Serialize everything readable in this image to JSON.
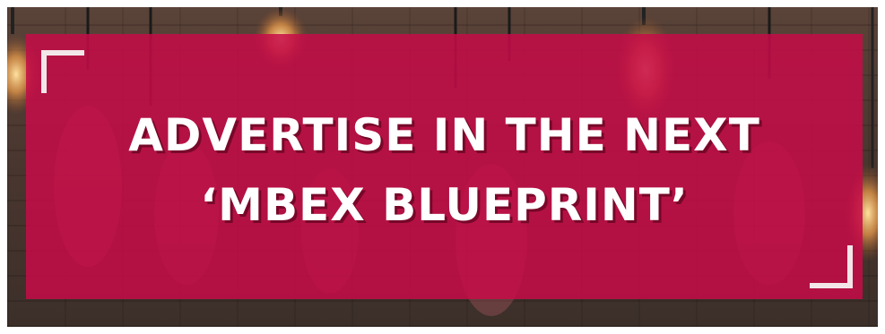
{
  "banner": {
    "line1": "ADVERTISE IN THE NEXT",
    "line2": "‘MBEX BLUEPRINT’"
  },
  "colors": {
    "overlay": "#c60c48",
    "text": "#ffffff",
    "corner": "#f2e6e9",
    "background": "#4a372f"
  },
  "icons": {
    "background_image": "hanging-light-bulbs"
  }
}
